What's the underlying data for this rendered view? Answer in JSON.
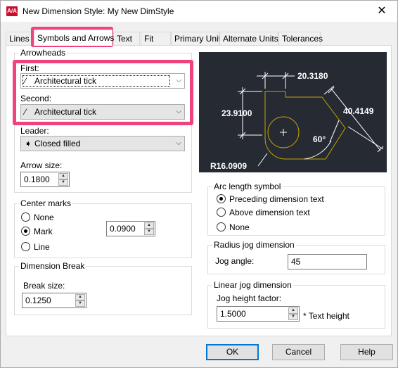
{
  "window": {
    "title": "New Dimension Style: My New DimStyle",
    "app_icon_text": "A/A",
    "close_glyph": "✕"
  },
  "tabs": [
    "Lines",
    "Symbols and Arrows",
    "Text",
    "Fit",
    "Primary Units",
    "Alternate Units",
    "Tolerances"
  ],
  "active_tab": "Symbols and Arrows",
  "arrowheads": {
    "title": "Arrowheads",
    "first_label": "First:",
    "first_value": "Architectural tick",
    "second_label": "Second:",
    "second_value": "Architectural tick",
    "leader_label": "Leader:",
    "leader_value": "Closed filled",
    "arrow_size_label": "Arrow size:",
    "arrow_size_value": "0.1800"
  },
  "center_marks": {
    "title": "Center marks",
    "options": [
      "None",
      "Mark",
      "Line"
    ],
    "selected": "Mark",
    "size_value": "0.0900"
  },
  "dimension_break": {
    "title": "Dimension Break",
    "break_size_label": "Break size:",
    "break_size_value": "0.1250"
  },
  "preview": {
    "dim_top": "20.3180",
    "dim_left": "23.9100",
    "dim_right": "40.4149",
    "angle": "60°",
    "radius": "R16.0909"
  },
  "arc_length": {
    "title": "Arc length symbol",
    "options": [
      "Preceding dimension text",
      "Above dimension text",
      "None"
    ],
    "selected": "Preceding dimension text"
  },
  "radius_jog": {
    "title": "Radius jog dimension",
    "jog_angle_label": "Jog angle:",
    "jog_angle_value": "45"
  },
  "linear_jog": {
    "title": "Linear jog dimension",
    "height_factor_label": "Jog height factor:",
    "height_factor_value": "1.5000",
    "suffix": "* Text height"
  },
  "buttons": {
    "ok": "OK",
    "cancel": "Cancel",
    "help": "Help"
  },
  "colors": {
    "highlight": "#f0427e",
    "preview_bg": "#252a33",
    "geometry": "#c8a200"
  }
}
